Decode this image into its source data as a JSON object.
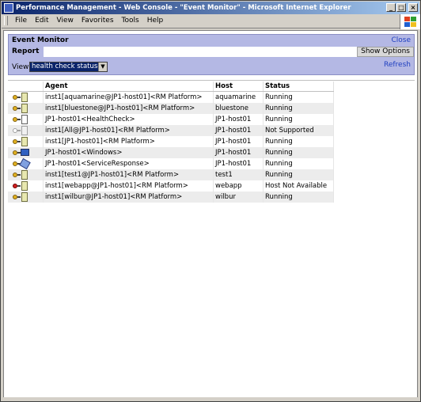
{
  "window": {
    "title": "Performance Management - Web Console - \"Event Monitor\" - Microsoft Internet Explorer"
  },
  "menu": [
    "File",
    "Edit",
    "View",
    "Favorites",
    "Tools",
    "Help"
  ],
  "panel": {
    "title": "Event Monitor",
    "close_label": "Close",
    "tab_report": "Report",
    "show_options_label": "Show Options",
    "view_label": "View",
    "view_selected": "health check statuses",
    "refresh_label": "Refresh"
  },
  "table": {
    "columns": [
      "Agent",
      "Host",
      "Status"
    ],
    "rows": [
      {
        "icon": "agent-icon",
        "agent": "inst1[aquamarine@JP1-host01]<RM Platform>",
        "host": "aquamarine",
        "status": "Running"
      },
      {
        "icon": "agent-icon",
        "agent": "inst1[bluestone@JP1-host01]<RM Platform>",
        "host": "bluestone",
        "status": "Running"
      },
      {
        "icon": "health-check-icon",
        "agent": "JP1-host01<HealthCheck>",
        "host": "JP1-host01",
        "status": "Running"
      },
      {
        "icon": "agent-not-supported-icon",
        "agent": "inst1[All@JP1-host01]<RM Platform>",
        "host": "JP1-host01",
        "status": "Not Supported"
      },
      {
        "icon": "agent-icon",
        "agent": "inst1[JP1-host01]<RM Platform>",
        "host": "JP1-host01",
        "status": "Running"
      },
      {
        "icon": "windows-agent-icon",
        "agent": "JP1-host01<Windows>",
        "host": "JP1-host01",
        "status": "Running"
      },
      {
        "icon": "service-response-icon",
        "agent": "JP1-host01<ServiceResponse>",
        "host": "JP1-host01",
        "status": "Running"
      },
      {
        "icon": "agent-icon",
        "agent": "inst1[test1@JP1-host01]<RM Platform>",
        "host": "test1",
        "status": "Running"
      },
      {
        "icon": "agent-error-icon",
        "agent": "inst1[webapp@JP1-host01]<RM Platform>",
        "host": "webapp",
        "status": "Host Not Available"
      },
      {
        "icon": "agent-icon",
        "agent": "inst1[wilbur@JP1-host01]<RM Platform>",
        "host": "wilbur",
        "status": "Running"
      }
    ]
  },
  "colors": {
    "title_bar": "#0a246a",
    "panel_bg": "#b4b8e4",
    "link": "#2040c0",
    "row_alt": "#ececec",
    "error_dot": "#d02020",
    "ok_dot": "#e0b020"
  }
}
